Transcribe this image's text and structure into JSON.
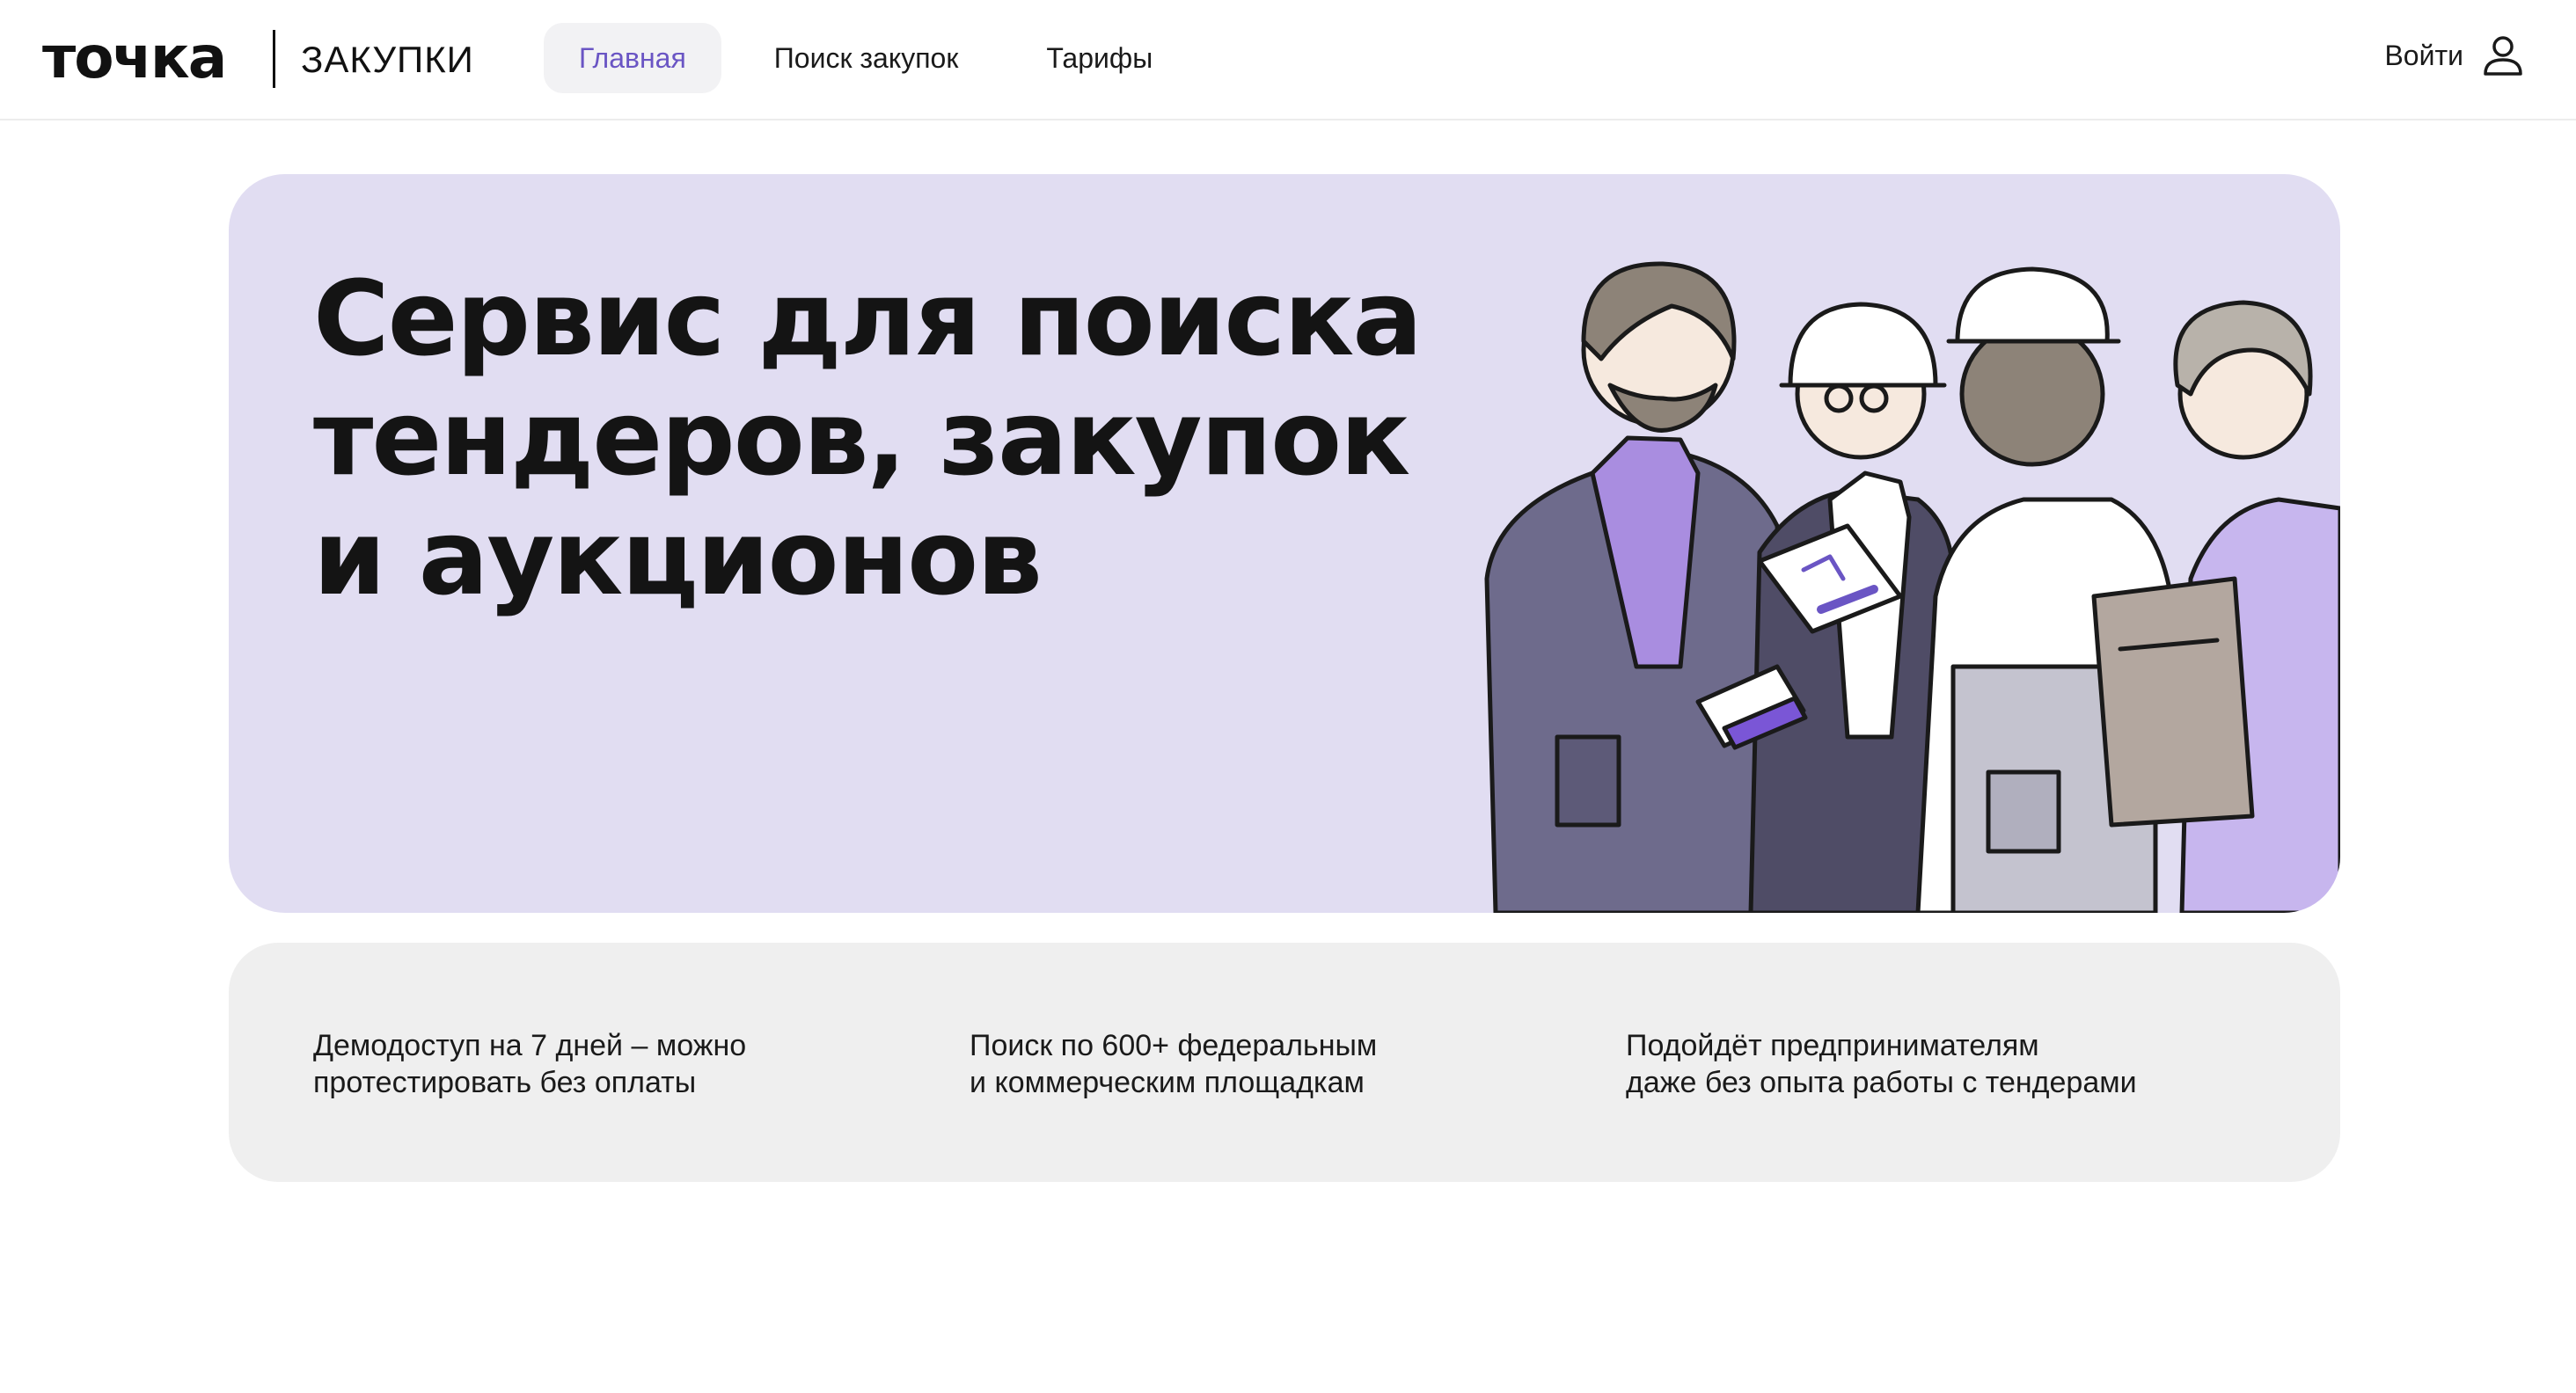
{
  "header": {
    "logo": "точка",
    "product": "ЗАКУПКИ",
    "nav": [
      {
        "label": "Главная",
        "active": true
      },
      {
        "label": "Поиск закупок",
        "active": false
      },
      {
        "label": "Тарифы",
        "active": false
      }
    ],
    "login_label": "Войти",
    "login_icon": "user-icon"
  },
  "hero": {
    "title": "Сервис для поиска\nтендеров, закупок\nи аукционов",
    "background": "#e1ddf2"
  },
  "features": [
    {
      "text": "Демодоступ на 7 дней – можно\nпротестировать без оплаты"
    },
    {
      "text": "Поиск по 600+ федеральным\nи коммерческим площадкам"
    },
    {
      "text": "Подойдёт предпринимателям\nдаже без опыта работы с тендерами"
    }
  ],
  "colors": {
    "accent": "#6a55c4",
    "hero_bg": "#e1ddf2",
    "features_bg": "#efefef"
  }
}
